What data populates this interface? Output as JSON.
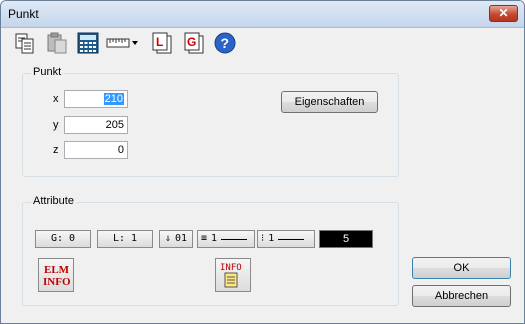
{
  "window": {
    "title": "Punkt",
    "close_glyph": "✕"
  },
  "toolbar": {
    "items": [
      {
        "name": "copy-icon"
      },
      {
        "name": "paste-icon"
      },
      {
        "name": "calculator-icon"
      },
      {
        "name": "ruler-dropdown-icon"
      },
      {
        "name": "layer-L-icon",
        "glyph": "L"
      },
      {
        "name": "group-G-icon",
        "glyph": "G"
      },
      {
        "name": "help-icon",
        "glyph": "?"
      }
    ]
  },
  "point_group": {
    "label": "Punkt",
    "x_label": "x",
    "x_value": "210",
    "y_label": "y",
    "y_value": "205",
    "z_label": "z",
    "z_value": "0",
    "properties_button": "Eigenschaften"
  },
  "attribute_group": {
    "label": "Attribute",
    "g_value": "G:  0",
    "l_value": "L:  1",
    "point_value": "01",
    "line_thickness": "1",
    "line_style": "1",
    "color_value": "5",
    "elm_info_line1": "ELM",
    "elm_info_line2": "INFO",
    "info_label": "INFO",
    "colors": {
      "elm_info": "#c00000",
      "info": "#c00000"
    }
  },
  "actions": {
    "ok": "OK",
    "cancel": "Abbrechen"
  }
}
